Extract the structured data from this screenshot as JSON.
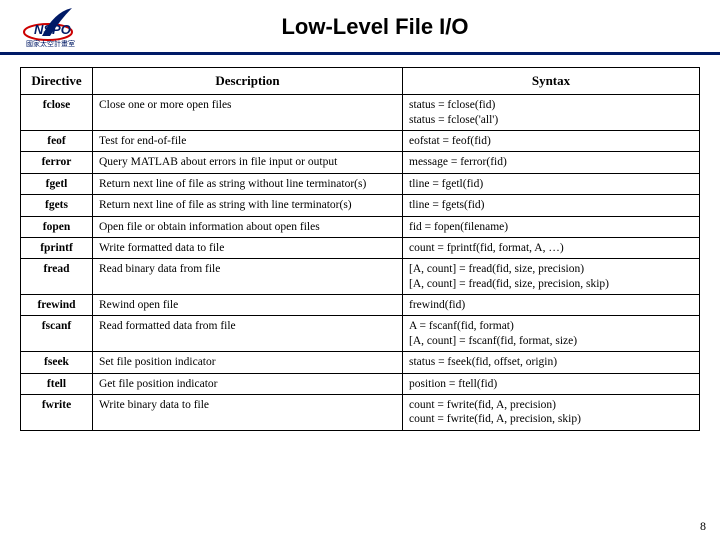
{
  "header": {
    "title": "Low-Level File I/O",
    "logo_label": "NSPO",
    "logo_sub": "國家太空計畫室"
  },
  "table": {
    "headers": {
      "directive": "Directive",
      "description": "Description",
      "syntax": "Syntax"
    },
    "rows": [
      {
        "directive": "fclose",
        "description": "Close one or more open files",
        "syntax": "status = fclose(fid)\nstatus = fclose('all')"
      },
      {
        "directive": "feof",
        "description": "Test for end-of-file",
        "syntax": "eofstat = feof(fid)"
      },
      {
        "directive": "ferror",
        "description": "Query MATLAB about errors in file input or output",
        "syntax": "message = ferror(fid)"
      },
      {
        "directive": "fgetl",
        "description": "Return next line of file as string without line terminator(s)",
        "syntax": "tline = fgetl(fid)"
      },
      {
        "directive": "fgets",
        "description": "Return next line of file as string with line terminator(s)",
        "syntax": "tline = fgets(fid)"
      },
      {
        "directive": "fopen",
        "description": "Open file or obtain information about open files",
        "syntax": "fid = fopen(filename)"
      },
      {
        "directive": "fprintf",
        "description": "Write formatted data to file",
        "syntax": "count = fprintf(fid, format, A, …)"
      },
      {
        "directive": "fread",
        "description": "Read binary data from file",
        "syntax": "[A, count] = fread(fid, size, precision)\n[A, count] = fread(fid, size, precision, skip)"
      },
      {
        "directive": "frewind",
        "description": "Rewind open file",
        "syntax": "frewind(fid)"
      },
      {
        "directive": "fscanf",
        "description": "Read formatted data from file",
        "syntax": "A = fscanf(fid, format)\n[A, count] = fscanf(fid, format, size)"
      },
      {
        "directive": "fseek",
        "description": "Set file position indicator",
        "syntax": "status = fseek(fid, offset, origin)"
      },
      {
        "directive": "ftell",
        "description": "Get file position indicator",
        "syntax": "position = ftell(fid)"
      },
      {
        "directive": "fwrite",
        "description": "Write binary data to file",
        "syntax": "count = fwrite(fid, A, precision)\ncount = fwrite(fid, A, precision, skip)"
      }
    ]
  },
  "page_number": "8"
}
